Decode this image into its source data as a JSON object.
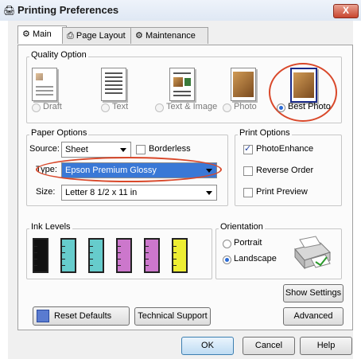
{
  "window": {
    "title": "Printing Preferences",
    "close_label": "X"
  },
  "tabs": [
    {
      "label": "Main"
    },
    {
      "label": "Page Layout"
    },
    {
      "label": "Maintenance"
    }
  ],
  "quality": {
    "group_label": "Quality Option",
    "options": [
      {
        "label": "Draft",
        "selected": false,
        "enabled": false
      },
      {
        "label": "Text",
        "selected": false,
        "enabled": false
      },
      {
        "label": "Text & Image",
        "selected": false,
        "enabled": false
      },
      {
        "label": "Photo",
        "selected": false,
        "enabled": false
      },
      {
        "label": "Best Photo",
        "selected": true,
        "enabled": true
      }
    ]
  },
  "paper": {
    "group_label": "Paper Options",
    "source_label": "Source:",
    "source_value": "Sheet",
    "borderless_label": "Borderless",
    "borderless_checked": false,
    "type_label": "Type:",
    "type_value": "Epson Premium Glossy",
    "size_label": "Size:",
    "size_value": "Letter 8 1/2 x 11 in"
  },
  "print_options": {
    "group_label": "Print Options",
    "items": [
      {
        "label": "PhotoEnhance",
        "checked": true
      },
      {
        "label": "Reverse Order",
        "checked": false
      },
      {
        "label": "Print Preview",
        "checked": false
      }
    ]
  },
  "ink": {
    "group_label": "Ink Levels",
    "colors": [
      "#111111",
      "#66cccc",
      "#66cccc",
      "#cc77cc",
      "#cc77cc",
      "#eeee33"
    ],
    "levels": [
      1.0,
      1.0,
      1.0,
      1.0,
      1.0,
      1.0
    ]
  },
  "orientation": {
    "group_label": "Orientation",
    "options": [
      {
        "label": "Portrait",
        "selected": false
      },
      {
        "label": "Landscape",
        "selected": true
      }
    ]
  },
  "buttons": {
    "show_settings": "Show Settings",
    "reset_defaults": "Reset Defaults",
    "technical_support": "Technical Support",
    "advanced": "Advanced",
    "ok": "OK",
    "cancel": "Cancel",
    "help": "Help"
  },
  "accent": "#3a78d6",
  "highlight_ring_color": "#d9482a"
}
